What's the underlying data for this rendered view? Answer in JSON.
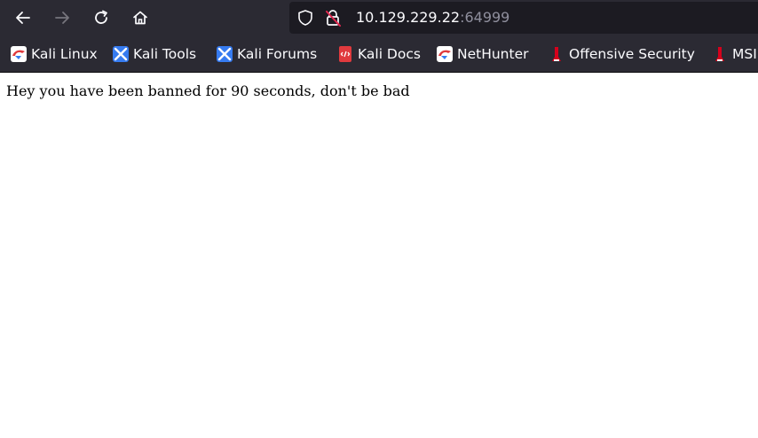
{
  "browser": {
    "url_host": "10.129.229.22",
    "url_port": ":64999"
  },
  "bookmarks": [
    {
      "label": "Kali Linux",
      "icon": "kali-dragon-icon"
    },
    {
      "label": "Kali Tools",
      "icon": "kali-tools-icon"
    },
    {
      "label": "Kali Forums",
      "icon": "kali-forums-icon"
    },
    {
      "label": "Kali Docs",
      "icon": "kali-docs-icon"
    },
    {
      "label": "NetHunter",
      "icon": "nethunter-icon"
    },
    {
      "label": "Offensive Security",
      "icon": "offsec-icon"
    },
    {
      "label": "MSI",
      "icon": "msfu-icon"
    }
  ],
  "page": {
    "message": "Hey you have been banned for 90 seconds, don't be bad"
  },
  "colors": {
    "toolbar_bg": "#2b2a33",
    "urlbar_bg": "#1c1b22",
    "kali_red": "#e03a3e",
    "kali_blue": "#367bf0",
    "offsec_red": "#d6001c"
  }
}
